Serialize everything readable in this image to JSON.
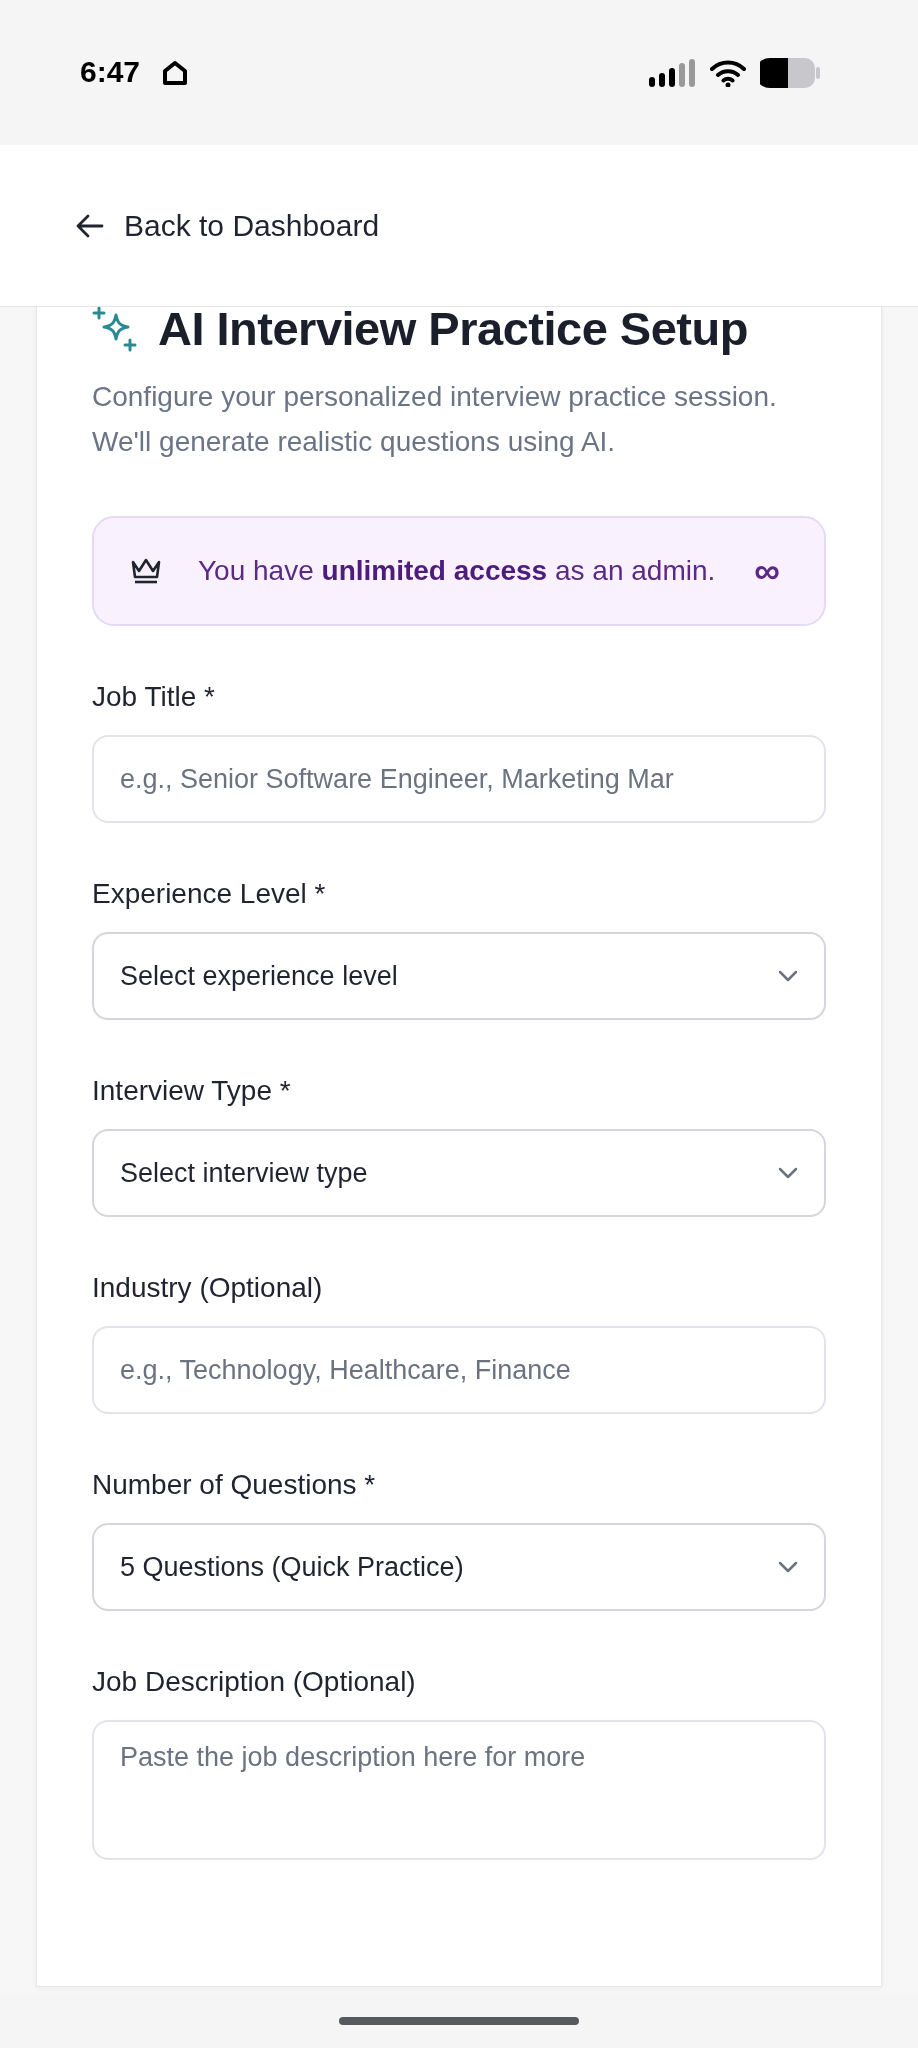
{
  "status_bar": {
    "time": "6:47"
  },
  "header": {
    "back_label": "Back to Dashboard"
  },
  "page": {
    "title": "AI Interview Practice Setup",
    "subtitle": "Configure your personalized interview practice session. We'll generate realistic questions using AI."
  },
  "notice": {
    "text": "You have **unlimited access** as an admin.",
    "badge": "∞"
  },
  "fields": [
    {
      "kind": "text",
      "label": "Job Title *",
      "placeholder": "e.g., Senior Software Engineer, Marketing Mar"
    },
    {
      "kind": "select",
      "label": "Experience Level *",
      "value": "Select experience level"
    },
    {
      "kind": "select",
      "label": "Interview Type *",
      "value": "Select interview type"
    },
    {
      "kind": "text",
      "label": "Industry (Optional)",
      "placeholder": "e.g., Technology, Healthcare, Finance"
    },
    {
      "kind": "select",
      "label": "Number of Questions *",
      "value": "5 Questions (Quick Practice)"
    },
    {
      "kind": "textarea",
      "label": "Job Description (Optional)",
      "placeholder": "Paste the job description here for more"
    }
  ]
}
